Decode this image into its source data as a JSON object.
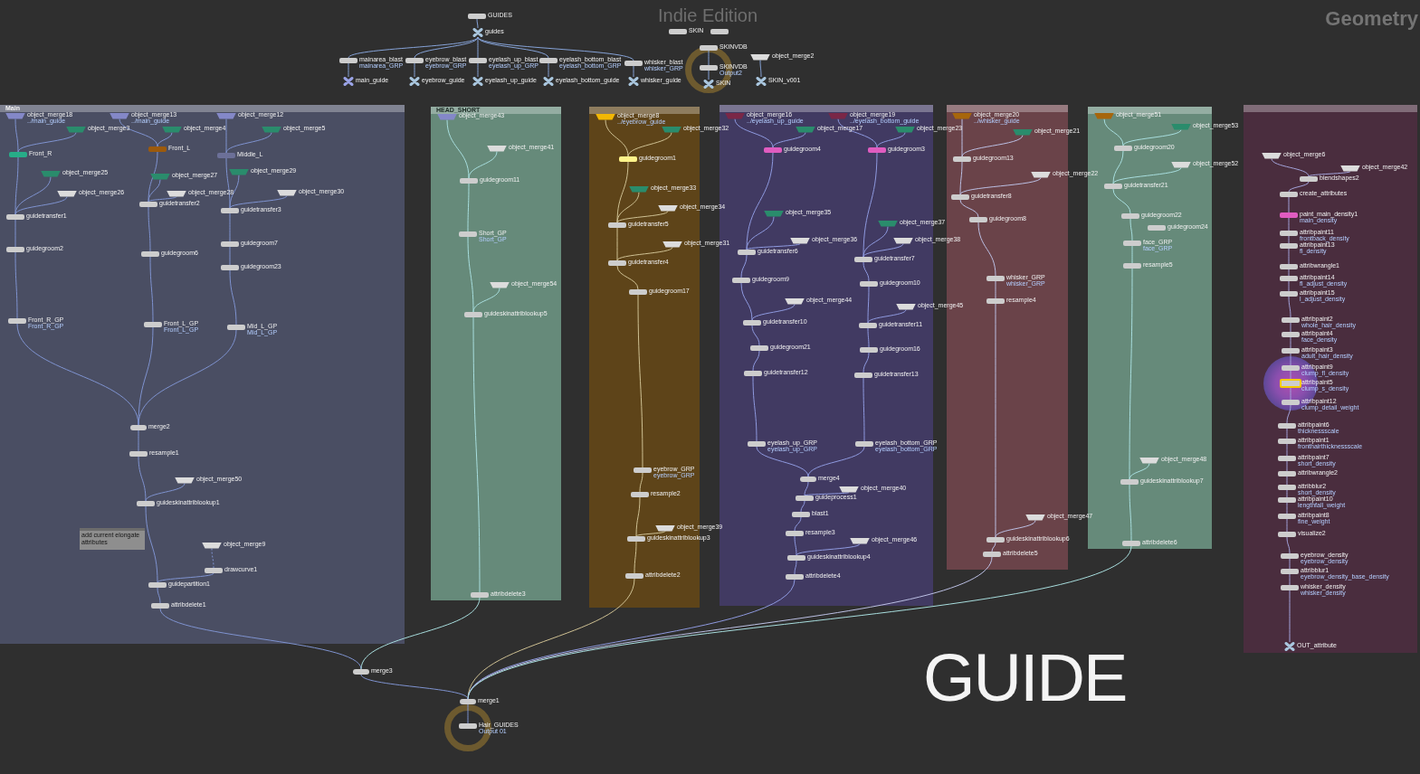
{
  "header": {
    "edition": "Indie Edition",
    "context": "Geometry"
  },
  "top_nodes": [
    {
      "name": "GUIDES",
      "kind": "sop",
      "color": "#cdcdcd",
      "selected": false
    },
    {
      "name": "guides",
      "kind": "null",
      "color": "#a9c6de",
      "selected": false
    },
    {
      "name": "mainarea_blast",
      "kind": "sop",
      "color": "#cdcdcd",
      "comment": "mainarea_GRP",
      "selected": false
    },
    {
      "name": "eyebrow_blast",
      "kind": "sop",
      "color": "#cdcdcd",
      "comment": "eyebrow_GRP",
      "selected": false
    },
    {
      "name": "eyelash_up_blast",
      "kind": "sop",
      "color": "#cdcdcd",
      "comment": "eyelash_up_GRP",
      "selected": false
    },
    {
      "name": "eyelash_bottom_blast",
      "kind": "sop",
      "color": "#cdcdcd",
      "comment": "eyelash_bottom_GRP",
      "selected": false
    },
    {
      "name": "whisker_blast",
      "kind": "sop",
      "color": "#cdcdcd",
      "comment": "whisker_GRP",
      "selected": false
    },
    {
      "name": "main_guide",
      "kind": "null",
      "color": "#9aa3e6",
      "selected": false
    },
    {
      "name": "eyebrow_guide",
      "kind": "null",
      "color": "#a9c6de",
      "selected": false
    },
    {
      "name": "eyelash_up_guide",
      "kind": "null",
      "color": "#a9c6de",
      "selected": false
    },
    {
      "name": "eyelash_bottom_guide",
      "kind": "null",
      "color": "#a9c6de",
      "selected": false
    },
    {
      "name": "whisker_guide",
      "kind": "null",
      "color": "#a9c6de",
      "selected": false
    },
    {
      "name": "SKIN",
      "kind": "sop",
      "color": "#cdcdcd",
      "selected": false
    },
    {
      "kind": "sop",
      "color": "#cdcdcd",
      "selected": false
    },
    {
      "name": "SKINVDB",
      "kind": "sop",
      "color": "#cdcdcd",
      "selected": false
    },
    {
      "name": "SKINVDB",
      "kind": "output",
      "color": "#cdcdcd",
      "comment": "Output2",
      "selected": false
    },
    {
      "name": "SKIN",
      "kind": "null",
      "color": "#a9c6de",
      "selected": false
    },
    {
      "name": "object_merge2",
      "kind": "object_merge",
      "color": "#dcdcdc",
      "selected": false
    },
    {
      "name": "SKIN_v001",
      "kind": "null",
      "color": "#a9c6de",
      "selected": false
    }
  ],
  "network_boxes": [
    {
      "title": "Main",
      "color": "#4a4e63",
      "sticky_note": {
        "text": "add current elongate attributes"
      },
      "nodes": [
        {
          "name": "object_merge18",
          "kind": "object_merge",
          "color": "#8488c8",
          "comment": "../main_guide",
          "selected": false
        },
        {
          "name": "object_merge3",
          "kind": "object_merge",
          "color": "#2a8c6c",
          "selected": false
        },
        {
          "name": "object_merge13",
          "kind": "object_merge",
          "color": "#8488c8",
          "comment": "../main_guide",
          "selected": false
        },
        {
          "name": "object_merge4",
          "kind": "object_merge",
          "color": "#2a8c6c",
          "selected": false
        },
        {
          "name": "object_merge12",
          "kind": "object_merge",
          "color": "#8488c8",
          "selected": false
        },
        {
          "name": "object_merge5",
          "kind": "object_merge",
          "color": "#2a8c6c",
          "selected": false
        },
        {
          "name": "Front_R",
          "kind": "sop",
          "color": "#27ad88",
          "selected": false
        },
        {
          "name": "Front_L",
          "kind": "sop",
          "color": "#9c5a0c",
          "selected": false
        },
        {
          "name": "Middle_L",
          "kind": "sop",
          "color": "#6c7098",
          "selected": false
        },
        {
          "name": "object_merge25",
          "kind": "object_merge",
          "color": "#2a8c6c",
          "selected": false
        },
        {
          "name": "object_merge26",
          "kind": "object_merge",
          "color": "#dcdcdc",
          "selected": false
        },
        {
          "name": "object_merge27",
          "kind": "object_merge",
          "color": "#2a8c6c",
          "selected": false
        },
        {
          "name": "object_merge28",
          "kind": "object_merge",
          "color": "#dcdcdc",
          "selected": false
        },
        {
          "name": "object_merge29",
          "kind": "object_merge",
          "color": "#2a8c6c",
          "selected": false
        },
        {
          "name": "object_merge30",
          "kind": "object_merge",
          "color": "#dcdcdc",
          "selected": false
        },
        {
          "name": "guidetransfer1",
          "kind": "sop",
          "color": "#cdcdcd",
          "selected": false
        },
        {
          "name": "guidetransfer2",
          "kind": "sop",
          "color": "#cdcdcd",
          "selected": false
        },
        {
          "name": "guidetransfer3",
          "kind": "sop",
          "color": "#cdcdcd",
          "selected": false
        },
        {
          "name": "guidegroom2",
          "kind": "sop",
          "color": "#cdcdcd",
          "selected": false
        },
        {
          "name": "guidegroom6",
          "kind": "sop",
          "color": "#cdcdcd",
          "selected": false
        },
        {
          "name": "guidegroom7",
          "kind": "sop",
          "color": "#cdcdcd",
          "selected": false
        },
        {
          "name": "guidegroom23",
          "kind": "sop",
          "color": "#cdcdcd",
          "selected": false
        },
        {
          "name": "Front_R_GP",
          "kind": "sop",
          "color": "#cdcdcd",
          "comment": "Front_R_GP",
          "selected": false
        },
        {
          "name": "Front_L_GP",
          "kind": "sop",
          "color": "#cdcdcd",
          "comment": "Front_L_GP",
          "selected": false
        },
        {
          "name": "Mid_L_GP",
          "kind": "sop",
          "color": "#cdcdcd",
          "comment": "Mid_L_GP",
          "selected": false
        },
        {
          "name": "merge2",
          "kind": "merge",
          "color": "#cdcdcd",
          "selected": false
        },
        {
          "name": "resample1",
          "kind": "sop",
          "color": "#cdcdcd",
          "selected": false
        },
        {
          "name": "object_merge50",
          "kind": "object_merge",
          "color": "#dcdcdc",
          "selected": false
        },
        {
          "name": "guideskinattriblookup1",
          "kind": "sop",
          "color": "#cdcdcd",
          "selected": false
        },
        {
          "name": "object_merge9",
          "kind": "object_merge",
          "color": "#dcdcdc",
          "selected": false
        },
        {
          "name": "drawcurve1",
          "kind": "sop",
          "color": "#cdcdcd",
          "selected": false
        },
        {
          "name": "guidepartition1",
          "kind": "sop",
          "color": "#cdcdcd",
          "selected": false
        },
        {
          "name": "attribdelete1",
          "kind": "sop",
          "color": "#cdcdcd",
          "selected": false
        }
      ]
    },
    {
      "title": "HEAD_SHORT",
      "color": "#668a7a",
      "nodes": [
        {
          "name": "object_merge43",
          "kind": "object_merge",
          "color": "#8488c8",
          "selected": false
        },
        {
          "name": "object_merge41",
          "kind": "object_merge",
          "color": "#dcdcdc",
          "selected": false
        },
        {
          "name": "guidegroom11",
          "kind": "sop",
          "color": "#cdcdcd",
          "selected": false
        },
        {
          "name": "Short_GP",
          "kind": "sop",
          "color": "#cdcdcd",
          "comment": "Short_GP",
          "selected": false
        },
        {
          "name": "object_merge54",
          "kind": "object_merge",
          "color": "#dcdcdc",
          "selected": false
        },
        {
          "name": "guideskinattriblookup5",
          "kind": "sop",
          "color": "#cdcdcd",
          "selected": false
        },
        {
          "name": "attribdelete3",
          "kind": "sop",
          "color": "#cdcdcd",
          "selected": false
        }
      ]
    },
    {
      "color": "#5e4419",
      "nodes": [
        {
          "name": "object_merge8",
          "kind": "object_merge",
          "color": "#f2b705",
          "comment": "../eyebrow_guide",
          "selected": false
        },
        {
          "name": "object_merge32",
          "kind": "object_merge",
          "color": "#2a8c6c",
          "selected": false
        },
        {
          "name": "guidegroom1",
          "kind": "sop",
          "color": "#fff38a",
          "selected": false
        },
        {
          "name": "object_merge33",
          "kind": "object_merge",
          "color": "#2a8c6c",
          "selected": false
        },
        {
          "name": "object_merge34",
          "kind": "object_merge",
          "color": "#dcdcdc",
          "selected": false
        },
        {
          "name": "guidetransfer5",
          "kind": "sop",
          "color": "#cdcdcd",
          "selected": false
        },
        {
          "name": "object_merge31",
          "kind": "object_merge",
          "color": "#dcdcdc",
          "selected": false
        },
        {
          "name": "guidetransfer4",
          "kind": "sop",
          "color": "#cdcdcd",
          "selected": false
        },
        {
          "name": "guidegroom17",
          "kind": "sop",
          "color": "#cdcdcd",
          "selected": false
        },
        {
          "name": "eyebrow_GRP",
          "kind": "sop",
          "color": "#cdcdcd",
          "comment": "eyebrow_GRP",
          "selected": false
        },
        {
          "name": "resample2",
          "kind": "sop",
          "color": "#cdcdcd",
          "selected": false
        },
        {
          "name": "object_merge39",
          "kind": "object_merge",
          "color": "#dcdcdc",
          "selected": false
        },
        {
          "name": "guideskinattriblookup3",
          "kind": "sop",
          "color": "#cdcdcd",
          "selected": false
        },
        {
          "name": "attribdelete2",
          "kind": "sop",
          "color": "#cdcdcd",
          "selected": false
        }
      ]
    },
    {
      "color": "#413a62",
      "nodes": [
        {
          "name": "object_merge16",
          "kind": "object_merge",
          "color": "#7a2747",
          "comment": "../eyelash_up_guide",
          "selected": false
        },
        {
          "name": "object_merge17",
          "kind": "object_merge",
          "color": "#2a8c6c",
          "selected": false
        },
        {
          "name": "object_merge19",
          "kind": "object_merge",
          "color": "#7a2747",
          "comment": "../eyelash_bottom_guide",
          "selected": false
        },
        {
          "name": "object_merge23",
          "kind": "object_merge",
          "color": "#2a8c6c",
          "selected": false
        },
        {
          "name": "guidegroom4",
          "kind": "sop",
          "color": "#e05cc0",
          "selected": false
        },
        {
          "name": "guidegroom3",
          "kind": "sop",
          "color": "#e05cc0",
          "selected": false
        },
        {
          "name": "object_merge35",
          "kind": "object_merge",
          "color": "#2a8c6c",
          "selected": false
        },
        {
          "name": "object_merge36",
          "kind": "object_merge",
          "color": "#dcdcdc",
          "selected": false
        },
        {
          "name": "guidetransfer6",
          "kind": "sop",
          "color": "#cdcdcd",
          "selected": false
        },
        {
          "name": "object_merge37",
          "kind": "object_merge",
          "color": "#2a8c6c",
          "selected": false
        },
        {
          "name": "object_merge38",
          "kind": "object_merge",
          "color": "#dcdcdc",
          "selected": false
        },
        {
          "name": "guidetransfer7",
          "kind": "sop",
          "color": "#cdcdcd",
          "selected": false
        },
        {
          "name": "guidegroom9",
          "kind": "sop",
          "color": "#cdcdcd",
          "selected": false
        },
        {
          "name": "guidegroom10",
          "kind": "sop",
          "color": "#cdcdcd",
          "selected": false
        },
        {
          "name": "object_merge44",
          "kind": "object_merge",
          "color": "#dcdcdc",
          "selected": false
        },
        {
          "name": "object_merge45",
          "kind": "object_merge",
          "color": "#dcdcdc",
          "selected": false
        },
        {
          "name": "guidetransfer10",
          "kind": "sop",
          "color": "#cdcdcd",
          "selected": false
        },
        {
          "name": "guidetransfer11",
          "kind": "sop",
          "color": "#cdcdcd",
          "selected": false
        },
        {
          "name": "guidegroom21",
          "kind": "sop",
          "color": "#cdcdcd",
          "selected": false
        },
        {
          "name": "guidegroom16",
          "kind": "sop",
          "color": "#cdcdcd",
          "selected": false
        },
        {
          "name": "guidetransfer12",
          "kind": "sop",
          "color": "#cdcdcd",
          "selected": false
        },
        {
          "name": "guidetransfer13",
          "kind": "sop",
          "color": "#cdcdcd",
          "selected": false
        },
        {
          "name": "eyelash_up_GRP",
          "kind": "sop",
          "color": "#cdcdcd",
          "comment": "eyelash_up_GRP",
          "selected": false
        },
        {
          "name": "eyelash_bottom_GRP",
          "kind": "sop",
          "color": "#cdcdcd",
          "comment": "eyelash_bottom_GRP",
          "selected": false
        },
        {
          "name": "merge4",
          "kind": "merge",
          "color": "#cdcdcd",
          "selected": false
        },
        {
          "name": "object_merge40",
          "kind": "object_merge",
          "color": "#dcdcdc",
          "selected": false
        },
        {
          "name": "guideprocess1",
          "kind": "sop",
          "color": "#cdcdcd",
          "selected": false
        },
        {
          "name": "blast1",
          "kind": "sop",
          "color": "#cdcdcd",
          "selected": false
        },
        {
          "name": "resample3",
          "kind": "sop",
          "color": "#cdcdcd",
          "selected": false
        },
        {
          "name": "object_merge46",
          "kind": "object_merge",
          "color": "#dcdcdc",
          "selected": false
        },
        {
          "name": "guideskinattriblookup4",
          "kind": "sop",
          "color": "#cdcdcd",
          "selected": false
        },
        {
          "name": "attribdelete4",
          "kind": "sop",
          "color": "#cdcdcd",
          "selected": false
        }
      ]
    },
    {
      "color": "#6a4349",
      "nodes": [
        {
          "name": "object_merge20",
          "kind": "object_merge",
          "color": "#a7660c",
          "comment": "../whisker_guide",
          "selected": false
        },
        {
          "name": "object_merge21",
          "kind": "object_merge",
          "color": "#2a8c6c",
          "selected": false
        },
        {
          "name": "guidegroom13",
          "kind": "sop",
          "color": "#cdcdcd",
          "selected": false
        },
        {
          "name": "object_merge22",
          "kind": "object_merge",
          "color": "#dcdcdc",
          "selected": false
        },
        {
          "name": "guidetransfer8",
          "kind": "sop",
          "color": "#cdcdcd",
          "selected": false
        },
        {
          "name": "guidegroom8",
          "kind": "sop",
          "color": "#cdcdcd",
          "selected": false
        },
        {
          "name": "whisker_GRP",
          "kind": "sop",
          "color": "#cdcdcd",
          "comment": "whisker_GRP",
          "selected": false
        },
        {
          "name": "resample4",
          "kind": "sop",
          "color": "#cdcdcd",
          "selected": false
        },
        {
          "name": "object_merge47",
          "kind": "object_merge",
          "color": "#dcdcdc",
          "selected": false
        },
        {
          "name": "guideskinattriblookup6",
          "kind": "sop",
          "color": "#cdcdcd",
          "selected": false
        },
        {
          "name": "attribdelete5",
          "kind": "sop",
          "color": "#cdcdcd",
          "selected": false
        }
      ]
    },
    {
      "color": "#668a7a",
      "nodes": [
        {
          "name": "object_merge51",
          "kind": "object_merge",
          "color": "#a7660c",
          "selected": false
        },
        {
          "name": "object_merge53",
          "kind": "object_merge",
          "color": "#2a8c6c",
          "selected": false
        },
        {
          "name": "guidegroom20",
          "kind": "sop",
          "color": "#cdcdcd",
          "selected": false
        },
        {
          "name": "object_merge52",
          "kind": "object_merge",
          "color": "#dcdcdc",
          "selected": false
        },
        {
          "name": "guidetransfer21",
          "kind": "sop",
          "color": "#cdcdcd",
          "selected": false
        },
        {
          "name": "guidegroom22",
          "kind": "sop",
          "color": "#cdcdcd",
          "selected": false
        },
        {
          "name": "guidegroom24",
          "kind": "sop",
          "color": "#cdcdcd",
          "selected": false
        },
        {
          "name": "face_GRP",
          "kind": "sop",
          "color": "#cdcdcd",
          "comment": "face_GRP",
          "selected": false
        },
        {
          "name": "resample5",
          "kind": "sop",
          "color": "#cdcdcd",
          "selected": false
        },
        {
          "name": "object_merge48",
          "kind": "object_merge",
          "color": "#dcdcdc",
          "selected": false
        },
        {
          "name": "guideskinattriblookup7",
          "kind": "sop",
          "color": "#cdcdcd",
          "selected": false
        },
        {
          "name": "attribdelete6",
          "kind": "sop",
          "color": "#cdcdcd",
          "selected": false
        }
      ]
    },
    {
      "color": "#4a2d3e",
      "nodes": [
        {
          "name": "object_merge6",
          "kind": "object_merge",
          "color": "#dcdcdc",
          "selected": false
        },
        {
          "name": "object_merge42",
          "kind": "object_merge",
          "color": "#dcdcdc",
          "selected": false
        },
        {
          "name": "blendshapes2",
          "kind": "sop",
          "color": "#cdcdcd",
          "selected": false
        },
        {
          "name": "create_attributes",
          "kind": "sop",
          "color": "#cdcdcd",
          "selected": false
        },
        {
          "name": "paint_main_density1",
          "kind": "sop",
          "color": "#e05cc0",
          "comment": "main_density",
          "selected": false
        },
        {
          "name": "attribpaint11",
          "kind": "sop",
          "color": "#cdcdcd",
          "comment": "frontback_density",
          "selected": false
        },
        {
          "name": "attribpaint13",
          "kind": "sop",
          "color": "#cdcdcd",
          "comment": "fl_density",
          "selected": false
        },
        {
          "name": "attribwrangle1",
          "kind": "sop",
          "color": "#cdcdcd",
          "selected": false
        },
        {
          "name": "attribpaint14",
          "kind": "sop",
          "color": "#cdcdcd",
          "comment": "fl_adjust_density",
          "selected": false
        },
        {
          "name": "attribpaint15",
          "kind": "sop",
          "color": "#cdcdcd",
          "comment": "l_adjust_density",
          "selected": false
        },
        {
          "name": "attribpaint2",
          "kind": "sop",
          "color": "#cdcdcd",
          "comment": "whole_hair_density",
          "selected": false
        },
        {
          "name": "attribpaint4",
          "kind": "sop",
          "color": "#cdcdcd",
          "comment": "face_density",
          "selected": false
        },
        {
          "name": "attribpaint3",
          "kind": "sop",
          "color": "#cdcdcd",
          "comment": "adult_hair_density",
          "selected": false
        },
        {
          "name": "attribpaint9",
          "kind": "sop",
          "color": "#cdcdcd",
          "comment": "clump_fl_density",
          "selected": false
        },
        {
          "name": "attribpaint5",
          "kind": "sop",
          "color": "#cdcdcd",
          "comment": "clump_s_density",
          "selected": true
        },
        {
          "name": "attribpaint12",
          "kind": "sop",
          "color": "#cdcdcd",
          "comment": "clump_detail_weight",
          "selected": false
        },
        {
          "name": "attribpaint6",
          "kind": "sop",
          "color": "#cdcdcd",
          "comment": "thicknessscale",
          "selected": false
        },
        {
          "name": "attribpaint1",
          "kind": "sop",
          "color": "#cdcdcd",
          "comment": "fronthairthicknessscale",
          "selected": false
        },
        {
          "name": "attribpaint7",
          "kind": "sop",
          "color": "#cdcdcd",
          "comment": "short_density",
          "selected": false
        },
        {
          "name": "attribwrangle2",
          "kind": "sop",
          "color": "#cdcdcd",
          "selected": false
        },
        {
          "name": "attribblur2",
          "kind": "sop",
          "color": "#cdcdcd",
          "comment": "short_density",
          "selected": false
        },
        {
          "name": "attribpaint10",
          "kind": "sop",
          "color": "#cdcdcd",
          "comment": "lengthfall_weight",
          "selected": false
        },
        {
          "name": "attribpaint8",
          "kind": "sop",
          "color": "#cdcdcd",
          "comment": "fine_weight",
          "selected": false
        },
        {
          "name": "visualize2",
          "kind": "sop",
          "color": "#cdcdcd",
          "selected": false
        },
        {
          "name": "eyebrow_density",
          "kind": "sop",
          "color": "#cdcdcd",
          "comment": "eyebrow_density",
          "selected": false
        },
        {
          "name": "attribblur1",
          "kind": "sop",
          "color": "#cdcdcd",
          "comment": "eyebrow_density_base_density",
          "selected": false
        },
        {
          "name": "whisker_density",
          "kind": "sop",
          "color": "#cdcdcd",
          "comment": "whisker_density",
          "selected": false
        },
        {
          "name": "OUT_attribute",
          "kind": "null",
          "color": "#a9c6de",
          "selected": false
        }
      ]
    }
  ],
  "bottom_nodes": [
    {
      "name": "merge3",
      "kind": "merge",
      "color": "#cdcdcd",
      "selected": false
    },
    {
      "name": "merge1",
      "kind": "merge",
      "color": "#cdcdcd",
      "selected": false
    },
    {
      "name": "Hair_GUIDES",
      "kind": "output",
      "color": "#cdcdcd",
      "comment": "Output 01",
      "selected": false
    }
  ],
  "canvas_label": "GUIDE"
}
